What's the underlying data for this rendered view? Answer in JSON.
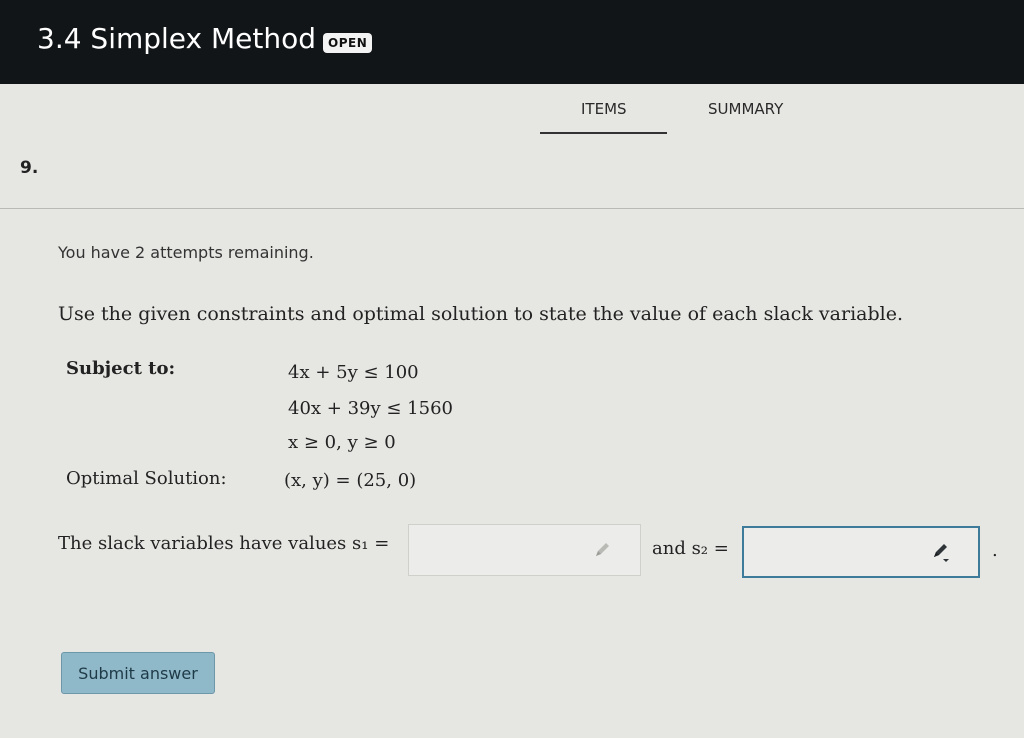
{
  "header": {
    "title": "3.4 Simplex Method",
    "badge": "OPEN"
  },
  "tabs": [
    {
      "label": "ITEMS",
      "active": true
    },
    {
      "label": "SUMMARY",
      "active": false
    }
  ],
  "question": {
    "number": "9.",
    "attempts": "You have 2 attempts remaining.",
    "instructions": "Use the given constraints and optimal solution to state the value of each slack variable.",
    "subject_label": "Subject to:",
    "constraints": [
      "4x + 5y ≤ 100",
      "40x + 39y ≤ 1560",
      "x ≥ 0, y ≥ 0"
    ],
    "optimal_label": "Optimal Solution:",
    "optimal_value": "(x, y) = (25, 0)",
    "slack_prompt": "The slack variables have values s₁ =",
    "and_text": "and s₂ =",
    "period": ".",
    "s1_value": "",
    "s2_value": ""
  },
  "submit_label": "Submit answer",
  "icons": {
    "field_edit": "pencil-icon"
  }
}
